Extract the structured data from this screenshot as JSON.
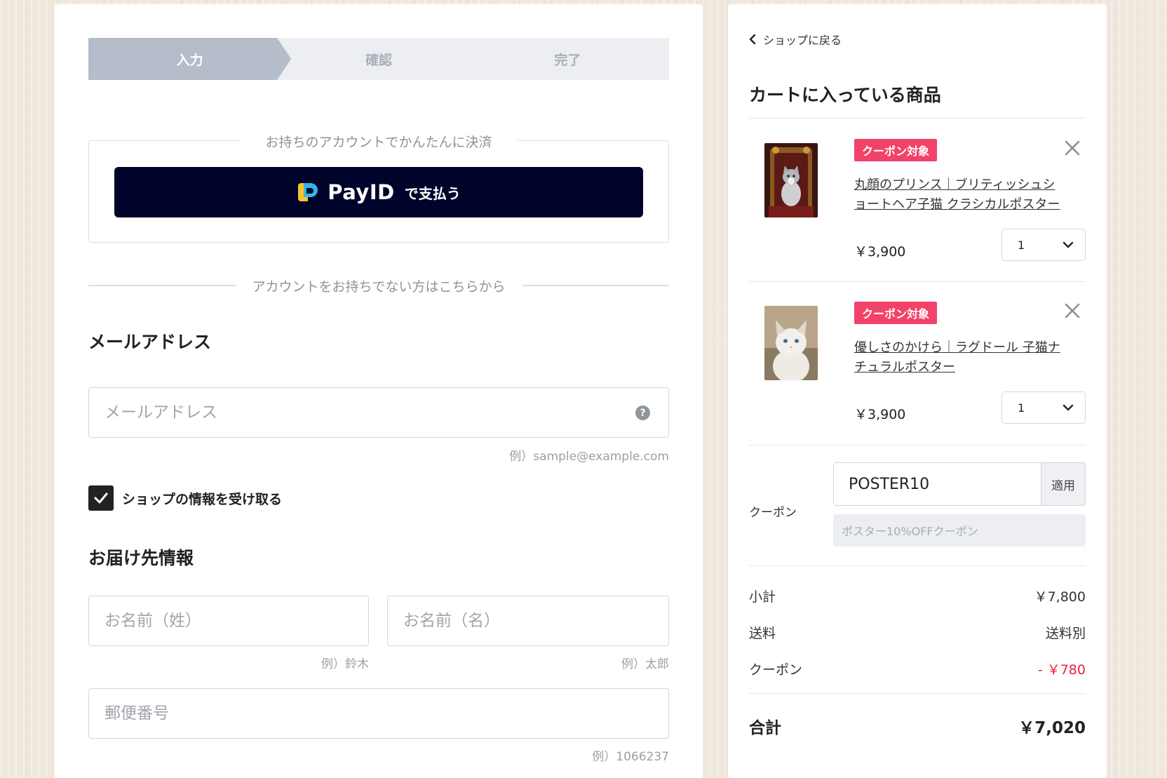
{
  "steps": [
    {
      "label": "入力",
      "active": true
    },
    {
      "label": "確認",
      "active": false
    },
    {
      "label": "完了",
      "active": false
    }
  ],
  "express": {
    "legend": "お持ちのアカウントでかんたんに決済",
    "payid_brand": "PayID",
    "payid_suffix": "で支払う"
  },
  "or_divider": "アカウントをお持ちでない方はこちらから",
  "email_section": {
    "title": "メールアドレス",
    "placeholder": "メールアドレス",
    "value": "",
    "example": "例）sample@example.com",
    "help_icon": "?"
  },
  "newsletter": {
    "label": "ショップの情報を受け取る",
    "checked": true
  },
  "shipping_section": {
    "title": "お届け先情報",
    "last_name_placeholder": "お名前（姓）",
    "last_name_example": "例）鈴木",
    "first_name_placeholder": "お名前（名）",
    "first_name_example": "例）太郎",
    "postal_placeholder": "郵便番号",
    "postal_example": "例）1066237"
  },
  "cart": {
    "back_link": "ショップに戻る",
    "title": "カートに入っている商品",
    "items": [
      {
        "badge": "クーポン対象",
        "name": "丸顔のプリンス｜ブリティッシュショートヘア子猫 クラシカルポスター",
        "price": "￥3,900",
        "quantity": "1",
        "thumb": "cat-on-throne"
      },
      {
        "badge": "クーポン対象",
        "name": "優しさのかけら｜ラグドール 子猫ナチュラルポスター",
        "price": "￥3,900",
        "quantity": "1",
        "thumb": "white-fluffy-kitten"
      }
    ],
    "coupon": {
      "label": "クーポン",
      "code": "POSTER10",
      "apply_label": "適用",
      "description": "ポスター10%OFFクーポン"
    },
    "summary": {
      "subtotal_label": "小計",
      "subtotal_value": "￥7,800",
      "shipping_label": "送料",
      "shipping_value": "送料別",
      "coupon_label": "クーポン",
      "coupon_value": "- ￥780",
      "total_label": "合計",
      "total_value": "￥7,020"
    }
  },
  "colors": {
    "step_active": "#b4bdc9",
    "step_inactive": "#eceef1",
    "payid_bg": "#01042a",
    "badge": "#f2426a",
    "discount": "#e8213d"
  }
}
